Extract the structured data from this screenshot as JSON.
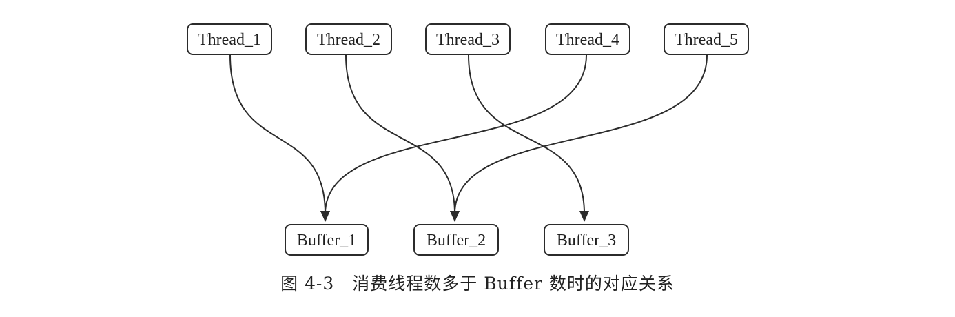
{
  "diagram": {
    "threads": [
      {
        "id": "t1",
        "label": "Thread_1"
      },
      {
        "id": "t2",
        "label": "Thread_2"
      },
      {
        "id": "t3",
        "label": "Thread_3"
      },
      {
        "id": "t4",
        "label": "Thread_4"
      },
      {
        "id": "t5",
        "label": "Thread_5"
      }
    ],
    "buffers": [
      {
        "id": "b1",
        "label": "Buffer_1"
      },
      {
        "id": "b2",
        "label": "Buffer_2"
      },
      {
        "id": "b3",
        "label": "Buffer_3"
      }
    ],
    "edges": [
      {
        "from": "t1",
        "to": "b1"
      },
      {
        "from": "t2",
        "to": "b2"
      },
      {
        "from": "t3",
        "to": "b3"
      },
      {
        "from": "t4",
        "to": "b1"
      },
      {
        "from": "t5",
        "to": "b2"
      }
    ]
  },
  "caption": "图 4-3　消费线程数多于 Buffer 数时的对应关系"
}
